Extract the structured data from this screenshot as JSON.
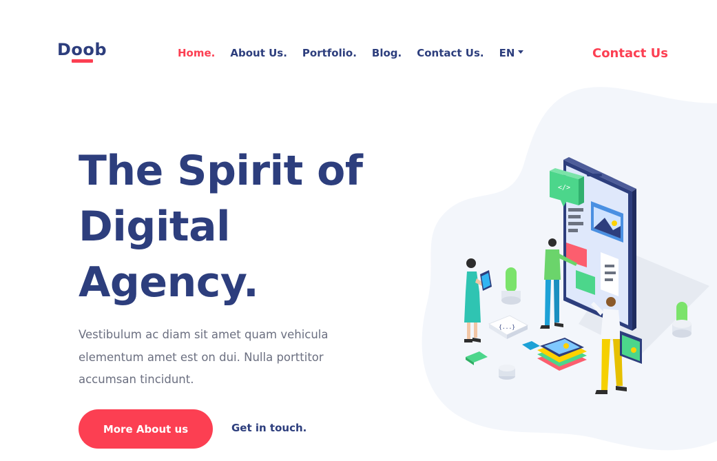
{
  "header": {
    "logo": "Doob",
    "nav": [
      {
        "label": "Home.",
        "active": true
      },
      {
        "label": "About Us.",
        "active": false
      },
      {
        "label": "Portfolio.",
        "active": false
      },
      {
        "label": "Blog.",
        "active": false
      },
      {
        "label": "Contact Us.",
        "active": false
      }
    ],
    "language": "EN",
    "cta": "Contact Us"
  },
  "hero": {
    "title_line1": "The Spirit of",
    "title_line2": "Digital",
    "title_line3": "Agency.",
    "description": "Vestibulum ac diam sit amet quam vehicula elementum amet est on dui. Nulla porttitor accumsan tincidunt.",
    "primary_button": "More About us",
    "secondary_link": "Get in touch."
  },
  "illustration": {
    "icon": "mobile-app-team-illustration",
    "code_badge": "</>",
    "code_tile": "{...}"
  },
  "colors": {
    "primary": "#2d3e7d",
    "accent": "#fc3f52",
    "body_text": "#6b6f80",
    "blob": "#f3f6fb"
  }
}
